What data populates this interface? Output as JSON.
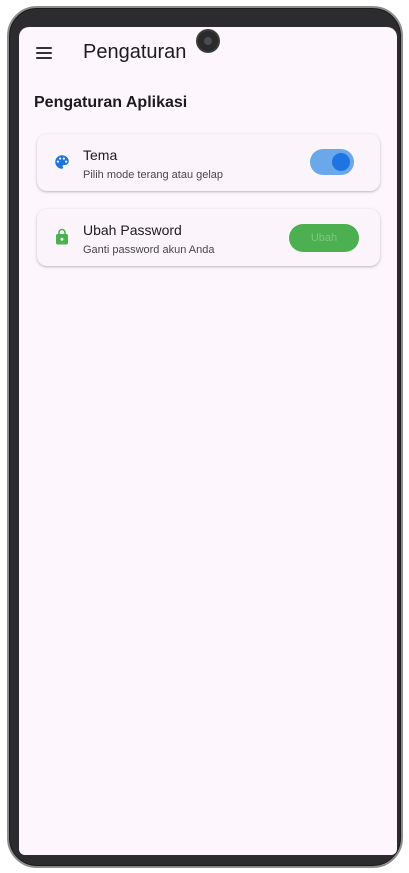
{
  "app_bar": {
    "title": "Pengaturan"
  },
  "section": {
    "title": "Pengaturan Aplikasi"
  },
  "settings": [
    {
      "icon": "palette-icon",
      "title": "Tema",
      "subtitle": "Pilih mode terang atau gelap",
      "control": "toggle",
      "toggle_on": true
    },
    {
      "icon": "lock-icon",
      "title": "Ubah Password",
      "subtitle": "Ganti password akun Anda",
      "control": "button",
      "button_label": "Ubah"
    }
  ],
  "colors": {
    "background": "#fdf7fd",
    "card": "#fbf4fb",
    "accent_blue": "#1e74e0",
    "toggle_track": "#6aa8ea",
    "accent_green": "#4caf50",
    "text_primary": "#1d1b20",
    "text_secondary": "#49454f"
  }
}
